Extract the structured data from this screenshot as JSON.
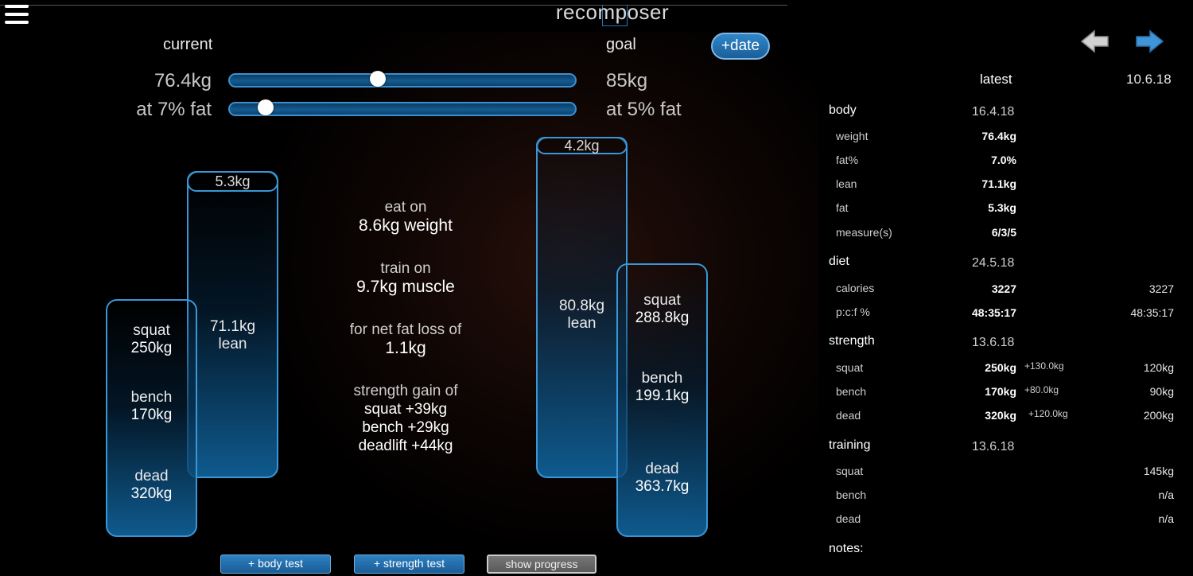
{
  "app": {
    "title": "recomposer"
  },
  "header": {
    "current_label": "current",
    "goal_label": "goal",
    "date_button": "+date"
  },
  "sliders": {
    "weight": {
      "current": "76.4kg",
      "goal": "85kg",
      "level_pct": 43
    },
    "fat": {
      "current": "at 7% fat",
      "goal": "at 5% fat",
      "level_pct": 9
    }
  },
  "current_columns": {
    "fat_cap": "5.3kg",
    "lean_value": "71.1kg",
    "lean_label": "lean",
    "squat_label": "squat",
    "squat_value": "250kg",
    "bench_label": "bench",
    "bench_value": "170kg",
    "dead_label": "dead",
    "dead_value": "320kg"
  },
  "goal_columns": {
    "fat_cap": "4.2kg",
    "lean_value": "80.8kg",
    "lean_label": "lean",
    "squat_label": "squat",
    "squat_value": "288.8kg",
    "bench_label": "bench",
    "bench_value": "199.1kg",
    "dead_label": "dead",
    "dead_value": "363.7kg"
  },
  "plan": {
    "eat_label": "eat on",
    "eat_value": "8.6kg weight",
    "train_label": "train on",
    "train_value": "9.7kg muscle",
    "fatloss_label": "for net fat loss of",
    "fatloss_value": "1.1kg",
    "strength_label": "strength gain of",
    "strength_squat": "squat +39kg",
    "strength_bench": "bench +29kg",
    "strength_dead": "deadlift +44kg"
  },
  "buttons": {
    "body_test": "+ body test",
    "strength_test": "+ strength test",
    "show_progress": "show progress"
  },
  "right_panel": {
    "header": {
      "latest": "latest",
      "date": "10.6.18"
    },
    "body": {
      "title": "body",
      "date": "16.4.18",
      "rows": [
        {
          "label": "weight",
          "value": "76.4kg"
        },
        {
          "label": "fat%",
          "value": "7.0%"
        },
        {
          "label": "lean",
          "value": "71.1kg"
        },
        {
          "label": "fat",
          "value": "5.3kg"
        },
        {
          "label": "measure(s)",
          "value": "6/3/5"
        }
      ]
    },
    "diet": {
      "title": "diet",
      "date": "24.5.18",
      "rows": [
        {
          "label": "calories",
          "value": "3227",
          "right": "3227"
        },
        {
          "label": "p:c:f %",
          "value": "48:35:17",
          "right": "48:35:17"
        }
      ]
    },
    "strength": {
      "title": "strength",
      "date": "13.6.18",
      "rows": [
        {
          "label": "squat",
          "value": "250kg",
          "gain": "+130.0kg",
          "right": "120kg"
        },
        {
          "label": "bench",
          "value": "170kg",
          "gain": "+80.0kg",
          "right": "90kg"
        },
        {
          "label": "dead",
          "value": "320kg",
          "gain": "+120.0kg",
          "right": "200kg"
        }
      ]
    },
    "training": {
      "title": "training",
      "date": "13.6.18",
      "rows": [
        {
          "label": "squat",
          "right": "145kg"
        },
        {
          "label": "bench",
          "right": "n/a"
        },
        {
          "label": "dead",
          "right": "n/a"
        }
      ]
    },
    "notes_label": "notes:"
  },
  "colors": {
    "accent": "#3a96d6",
    "button": "#2f86c8",
    "arrow_next": "#3f95d8",
    "arrow_prev": "#cfcfcf"
  },
  "icons": {
    "menu": "hamburger-menu-icon",
    "prev": "arrow-left-icon",
    "next": "arrow-right-icon"
  }
}
